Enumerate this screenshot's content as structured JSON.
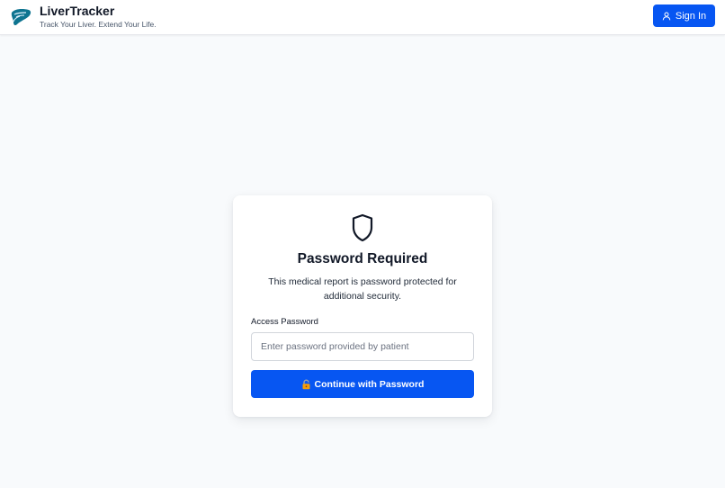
{
  "header": {
    "app_name": "LiverTracker",
    "tagline": "Track Your Liver. Extend Your Life.",
    "logo_icon": "liver-icon",
    "sign_in_label": "Sign In",
    "sign_in_icon": "user-icon"
  },
  "card": {
    "icon": "shield-icon",
    "title": "Password Required",
    "description": "This medical report is password protected for additional security.",
    "field_label": "Access Password",
    "input_placeholder": "Enter password provided by patient",
    "input_value": "",
    "button_label": "Continue with Password",
    "button_icon": "lock-icon"
  },
  "colors": {
    "accent": "#0756f2",
    "background": "#f8fafc",
    "card": "#ffffff",
    "logo": "#0e7490"
  }
}
